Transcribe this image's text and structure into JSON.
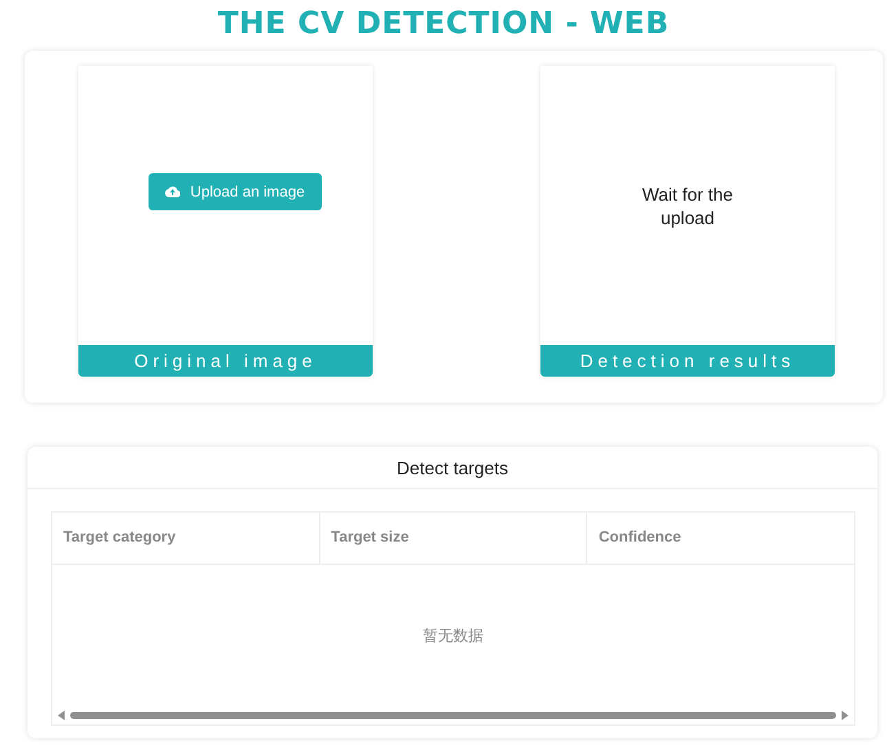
{
  "title": "THE CV DETECTION - WEB",
  "panels": [
    {
      "kind": "upload",
      "button": "Upload an image",
      "caption": "Original image"
    },
    {
      "kind": "result",
      "message": "Wait for the upload",
      "caption": "Detection results"
    }
  ],
  "targets": {
    "title": "Detect targets",
    "columns": [
      "Target category",
      "Target size",
      "Confidence"
    ],
    "empty_text": "暂无数据"
  }
}
